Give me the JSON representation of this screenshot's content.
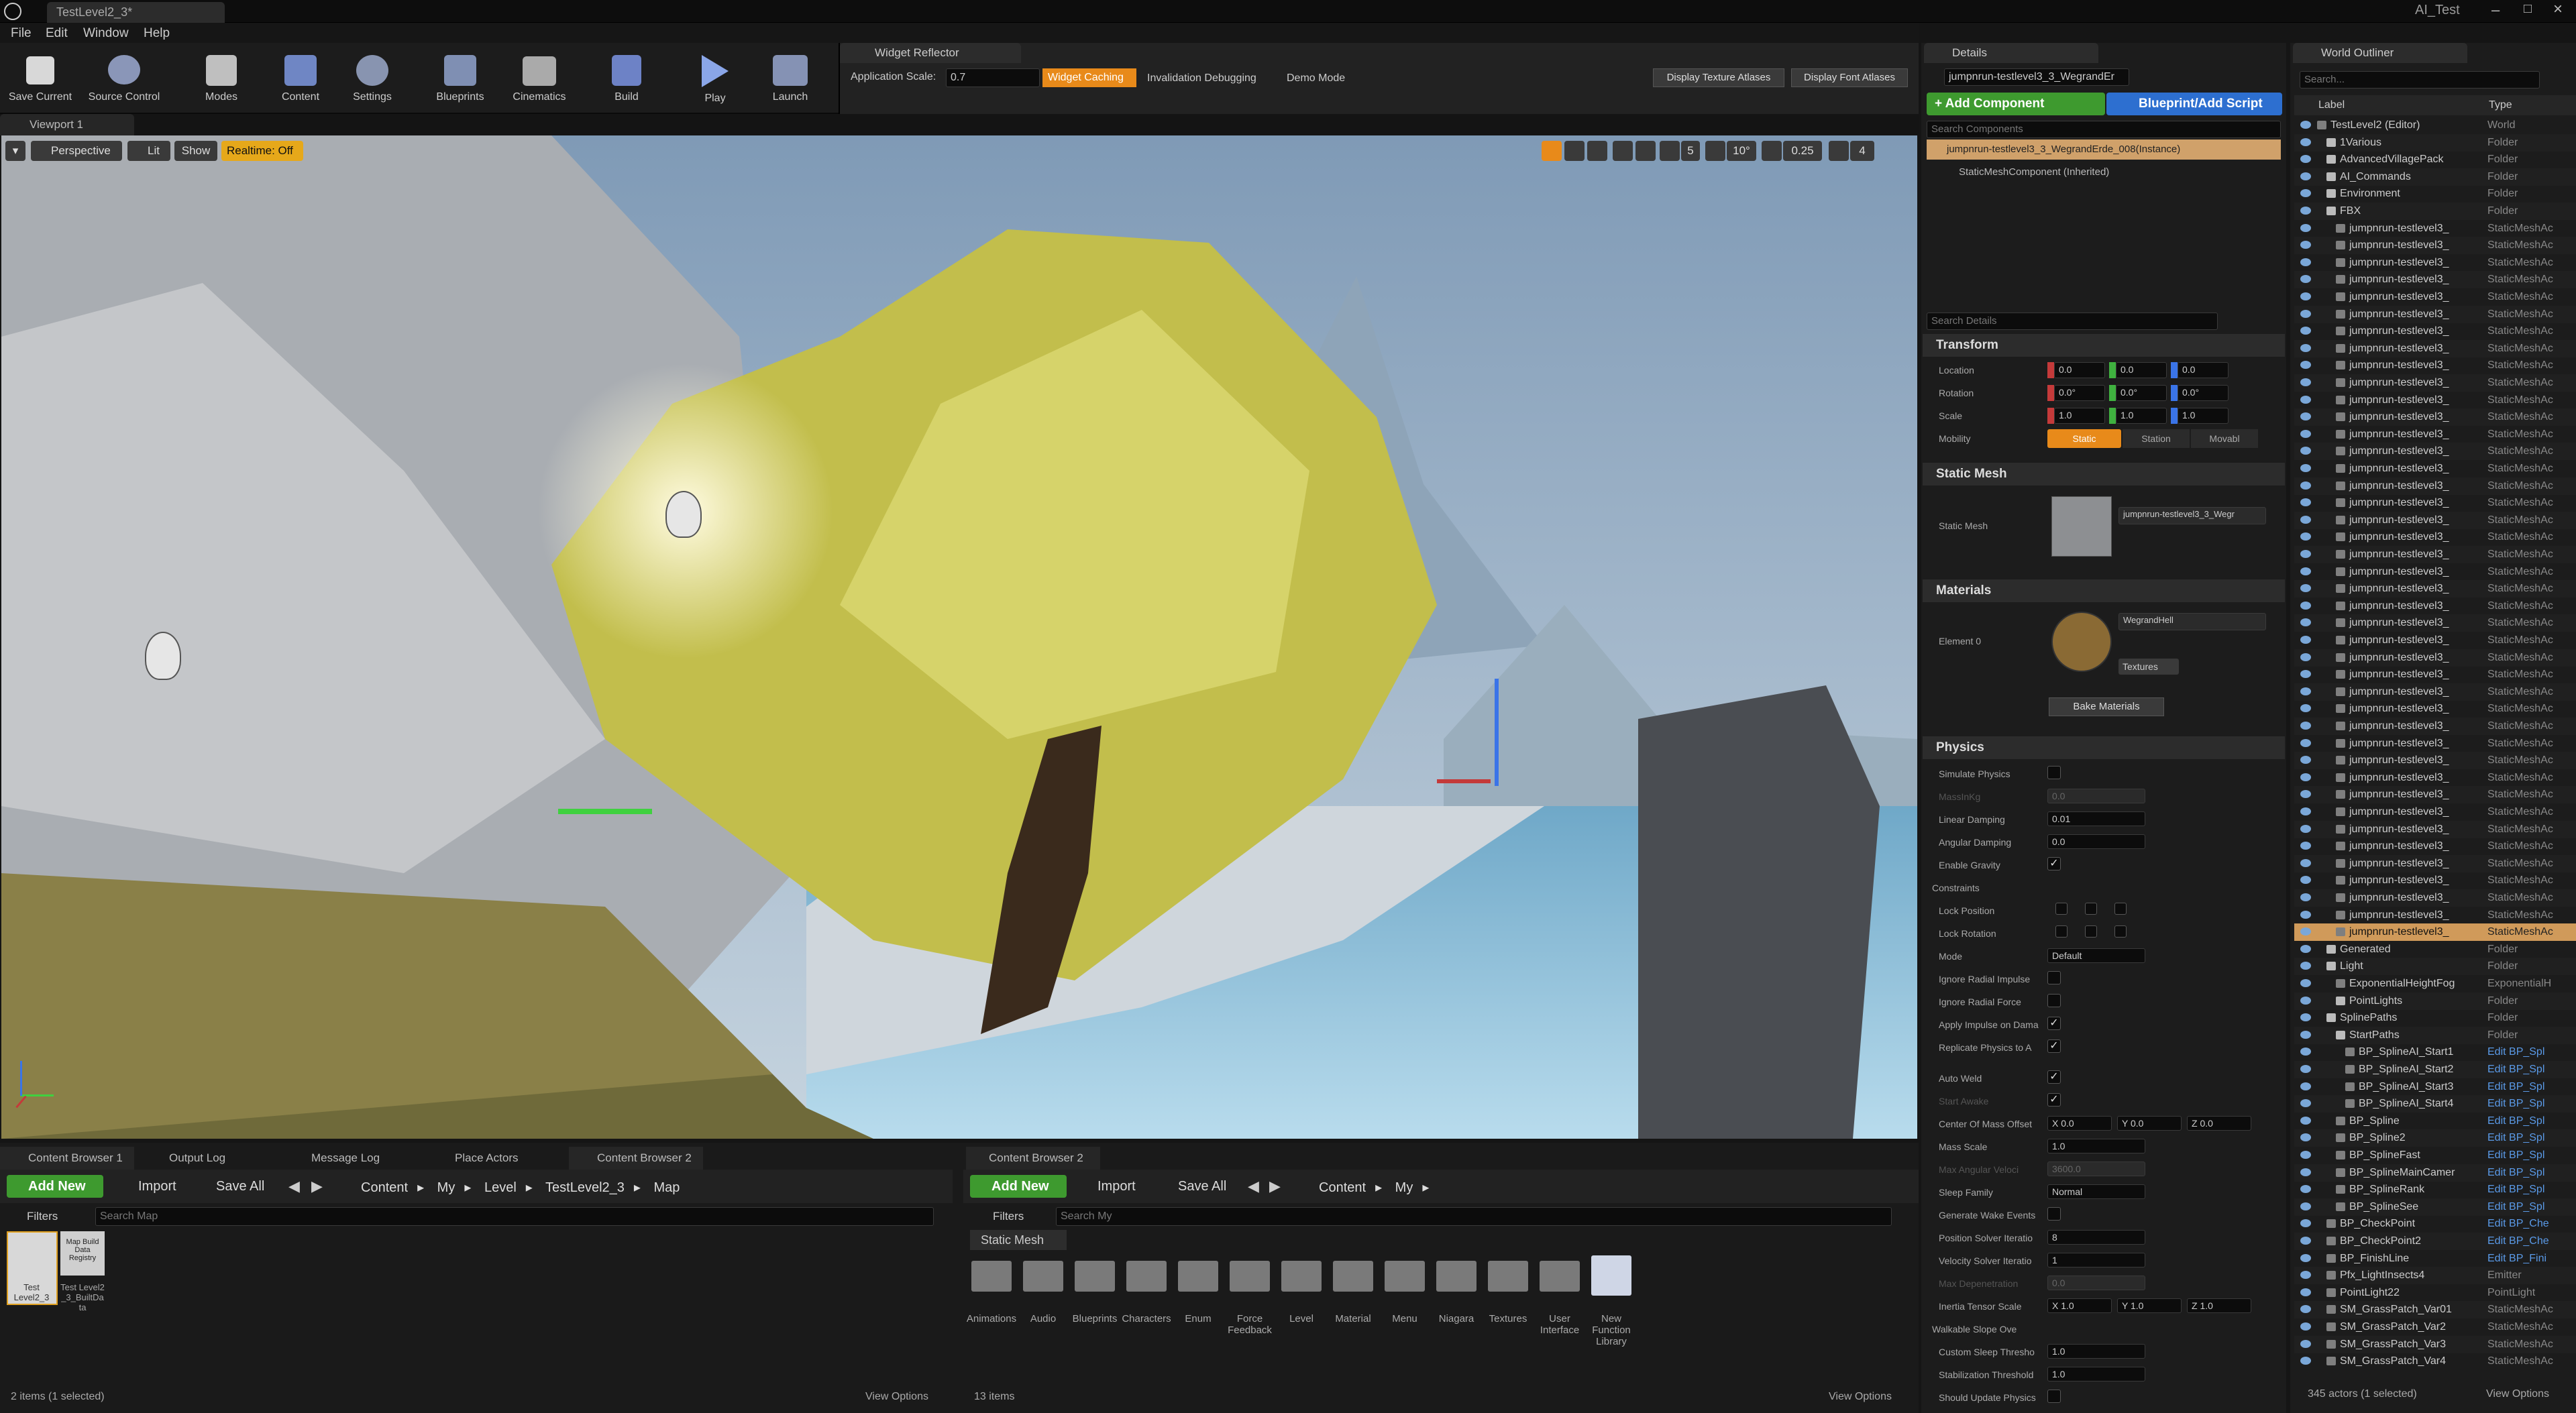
{
  "window": {
    "doc_tab": "TestLevel2_3*",
    "project": "AI_Test"
  },
  "menu": [
    "File",
    "Edit",
    "Window",
    "Help"
  ],
  "toolbar": [
    "Save Current",
    "Source Control",
    "Modes",
    "Content",
    "Settings",
    "Blueprints",
    "Cinematics",
    "Build",
    "Play",
    "Launch"
  ],
  "widget_reflector": {
    "tab": "Widget Reflector",
    "app_scale_label": "Application Scale:",
    "app_scale_value": "0.7",
    "widget_caching": "Widget Caching",
    "invalidation": "Invalidation Debugging",
    "demo": "Demo Mode",
    "tex_atlases": "Display Texture Atlases",
    "font_atlases": "Display Font Atlases"
  },
  "viewport": {
    "tab": "Viewport 1",
    "perspective": "Perspective",
    "lit": "Lit",
    "show": "Show",
    "realtime": "Realtime: Off",
    "grid_num": "5",
    "angle": "10°",
    "scale": "0.25",
    "cams": "4"
  },
  "details": {
    "tab": "Details",
    "name": "jumpnrun-testlevel3_3_WegrandEr",
    "add_component": "+ Add Component",
    "blueprint": "Blueprint/Add Script",
    "search_components": "Search Components",
    "instance": "jumpnrun-testlevel3_3_WegrandErde_008(Instance)",
    "smc": "StaticMeshComponent (Inherited)",
    "search_details": "Search Details",
    "transform": "Transform",
    "location": "Location",
    "rotation": "Rotation",
    "scale": "Scale",
    "mobility": "Mobility",
    "loc": [
      "0.0",
      "0.0",
      "0.0"
    ],
    "rot": [
      "0.0°",
      "0.0°",
      "0.0°"
    ],
    "scl": [
      "1.0",
      "1.0",
      "1.0"
    ],
    "mob": [
      "Static",
      "Station",
      "Movabl"
    ],
    "static_mesh_sec": "Static Mesh",
    "static_mesh_label": "Static Mesh",
    "static_mesh_val": "jumpnrun-testlevel3_3_Wegr",
    "materials_sec": "Materials",
    "element0": "Element 0",
    "material_val": "WegrandHell",
    "textures": "Textures",
    "bake": "Bake Materials",
    "physics_sec": "Physics",
    "simulate": "Simulate Physics",
    "masskg": "MassInKg",
    "masskg_val": "0.0",
    "linear": "Linear Damping",
    "linear_val": "0.01",
    "angular": "Angular Damping",
    "angular_val": "0.0",
    "gravity": "Enable Gravity",
    "constraints": "Constraints",
    "lockpos": "Lock Position",
    "lockrot": "Lock Rotation",
    "mode": "Mode",
    "mode_val": "Default",
    "radial_imp": "Ignore Radial Impulse",
    "radial_force": "Ignore Radial Force",
    "apply_imp": "Apply Impulse on Dama",
    "replicate": "Replicate Physics to A",
    "autoweld": "Auto Weld",
    "start_awake": "Start Awake",
    "com": "Center Of Mass Offset",
    "com_vals": [
      "X 0.0",
      "Y 0.0",
      "Z 0.0"
    ],
    "massscale": "Mass Scale",
    "massscale_val": "1.0",
    "maxang": "Max Angular Veloci",
    "maxang_val": "3600.0",
    "sleepfam": "Sleep Family",
    "sleepfam_val": "Normal",
    "wake": "Generate Wake Events",
    "possolver": "Position Solver Iteratio",
    "possolver_val": "8",
    "velsolver": "Velocity Solver Iteratio",
    "velsolver_val": "1",
    "maxdep": "Max Depenetration",
    "maxdep_val": "0.0",
    "inertia": "Inertia Tensor Scale",
    "inertia_vals": [
      "X 1.0",
      "Y 1.0",
      "Z 1.0"
    ],
    "walkable": "Walkable Slope Ove",
    "customsleep": "Custom Sleep Thresho",
    "customsleep_val": "1.0",
    "stab": "Stabilization Threshold",
    "stab_val": "1.0",
    "shouldupdate": "Should Update Physics"
  },
  "outliner": {
    "tab": "World Outliner",
    "search": "Search...",
    "col_label": "Label",
    "col_type": "Type",
    "footer": "345 actors (1 selected)",
    "view_options": "View Options",
    "rows": [
      {
        "n": "TestLevel2 (Editor)",
        "t": "World",
        "d": 0
      },
      {
        "n": "1Various",
        "t": "Folder",
        "d": 1
      },
      {
        "n": "AdvancedVillagePack",
        "t": "Folder",
        "d": 1
      },
      {
        "n": "AI_Commands",
        "t": "Folder",
        "d": 1
      },
      {
        "n": "Environment",
        "t": "Folder",
        "d": 1
      },
      {
        "n": "FBX",
        "t": "Folder",
        "d": 1
      },
      {
        "n": "jumpnrun-testlevel3_",
        "t": "StaticMeshAc",
        "d": 2
      },
      {
        "n": "jumpnrun-testlevel3_",
        "t": "StaticMeshAc",
        "d": 2
      },
      {
        "n": "jumpnrun-testlevel3_",
        "t": "StaticMeshAc",
        "d": 2
      },
      {
        "n": "jumpnrun-testlevel3_",
        "t": "StaticMeshAc",
        "d": 2
      },
      {
        "n": "jumpnrun-testlevel3_",
        "t": "StaticMeshAc",
        "d": 2
      },
      {
        "n": "jumpnrun-testlevel3_",
        "t": "StaticMeshAc",
        "d": 2
      },
      {
        "n": "jumpnrun-testlevel3_",
        "t": "StaticMeshAc",
        "d": 2
      },
      {
        "n": "jumpnrun-testlevel3_",
        "t": "StaticMeshAc",
        "d": 2
      },
      {
        "n": "jumpnrun-testlevel3_",
        "t": "StaticMeshAc",
        "d": 2
      },
      {
        "n": "jumpnrun-testlevel3_",
        "t": "StaticMeshAc",
        "d": 2
      },
      {
        "n": "jumpnrun-testlevel3_",
        "t": "StaticMeshAc",
        "d": 2
      },
      {
        "n": "jumpnrun-testlevel3_",
        "t": "StaticMeshAc",
        "d": 2
      },
      {
        "n": "jumpnrun-testlevel3_",
        "t": "StaticMeshAc",
        "d": 2
      },
      {
        "n": "jumpnrun-testlevel3_",
        "t": "StaticMeshAc",
        "d": 2
      },
      {
        "n": "jumpnrun-testlevel3_",
        "t": "StaticMeshAc",
        "d": 2
      },
      {
        "n": "jumpnrun-testlevel3_",
        "t": "StaticMeshAc",
        "d": 2
      },
      {
        "n": "jumpnrun-testlevel3_",
        "t": "StaticMeshAc",
        "d": 2
      },
      {
        "n": "jumpnrun-testlevel3_",
        "t": "StaticMeshAc",
        "d": 2
      },
      {
        "n": "jumpnrun-testlevel3_",
        "t": "StaticMeshAc",
        "d": 2
      },
      {
        "n": "jumpnrun-testlevel3_",
        "t": "StaticMeshAc",
        "d": 2
      },
      {
        "n": "jumpnrun-testlevel3_",
        "t": "StaticMeshAc",
        "d": 2
      },
      {
        "n": "jumpnrun-testlevel3_",
        "t": "StaticMeshAc",
        "d": 2
      },
      {
        "n": "jumpnrun-testlevel3_",
        "t": "StaticMeshAc",
        "d": 2
      },
      {
        "n": "jumpnrun-testlevel3_",
        "t": "StaticMeshAc",
        "d": 2
      },
      {
        "n": "jumpnrun-testlevel3_",
        "t": "StaticMeshAc",
        "d": 2
      },
      {
        "n": "jumpnrun-testlevel3_",
        "t": "StaticMeshAc",
        "d": 2
      },
      {
        "n": "jumpnrun-testlevel3_",
        "t": "StaticMeshAc",
        "d": 2
      },
      {
        "n": "jumpnrun-testlevel3_",
        "t": "StaticMeshAc",
        "d": 2
      },
      {
        "n": "jumpnrun-testlevel3_",
        "t": "StaticMeshAc",
        "d": 2
      },
      {
        "n": "jumpnrun-testlevel3_",
        "t": "StaticMeshAc",
        "d": 2
      },
      {
        "n": "jumpnrun-testlevel3_",
        "t": "StaticMeshAc",
        "d": 2
      },
      {
        "n": "jumpnrun-testlevel3_",
        "t": "StaticMeshAc",
        "d": 2
      },
      {
        "n": "jumpnrun-testlevel3_",
        "t": "StaticMeshAc",
        "d": 2
      },
      {
        "n": "jumpnrun-testlevel3_",
        "t": "StaticMeshAc",
        "d": 2
      },
      {
        "n": "jumpnrun-testlevel3_",
        "t": "StaticMeshAc",
        "d": 2
      },
      {
        "n": "jumpnrun-testlevel3_",
        "t": "StaticMeshAc",
        "d": 2
      },
      {
        "n": "jumpnrun-testlevel3_",
        "t": "StaticMeshAc",
        "d": 2
      },
      {
        "n": "jumpnrun-testlevel3_",
        "t": "StaticMeshAc",
        "d": 2
      },
      {
        "n": "jumpnrun-testlevel3_",
        "t": "StaticMeshAc",
        "d": 2
      },
      {
        "n": "jumpnrun-testlevel3_",
        "t": "StaticMeshAc",
        "d": 2
      },
      {
        "n": "jumpnrun-testlevel3_",
        "t": "StaticMeshAc",
        "d": 2
      },
      {
        "n": "jumpnrun-testlevel3_",
        "t": "StaticMeshAc",
        "d": 2,
        "sel": true
      },
      {
        "n": "Generated",
        "t": "Folder",
        "d": 1
      },
      {
        "n": "Light",
        "t": "Folder",
        "d": 1
      },
      {
        "n": "ExponentialHeightFog",
        "t": "ExponentialH",
        "d": 2
      },
      {
        "n": "PointLights",
        "t": "Folder",
        "d": 2
      },
      {
        "n": "SplinePaths",
        "t": "Folder",
        "d": 1
      },
      {
        "n": "StartPaths",
        "t": "Folder",
        "d": 2
      },
      {
        "n": "BP_SplineAI_Start1",
        "t": "Edit BP_Spl",
        "d": 3,
        "link": true
      },
      {
        "n": "BP_SplineAI_Start2",
        "t": "Edit BP_Spl",
        "d": 3,
        "link": true
      },
      {
        "n": "BP_SplineAI_Start3",
        "t": "Edit BP_Spl",
        "d": 3,
        "link": true
      },
      {
        "n": "BP_SplineAI_Start4",
        "t": "Edit BP_Spl",
        "d": 3,
        "link": true
      },
      {
        "n": "BP_Spline",
        "t": "Edit BP_Spl",
        "d": 2,
        "link": true
      },
      {
        "n": "BP_Spline2",
        "t": "Edit BP_Spl",
        "d": 2,
        "link": true
      },
      {
        "n": "BP_SplineFast",
        "t": "Edit BP_Spl",
        "d": 2,
        "link": true
      },
      {
        "n": "BP_SplineMainCamer",
        "t": "Edit BP_Spl",
        "d": 2,
        "link": true
      },
      {
        "n": "BP_SplineRank",
        "t": "Edit BP_Spl",
        "d": 2,
        "link": true
      },
      {
        "n": "BP_SplineSee",
        "t": "Edit BP_Spl",
        "d": 2,
        "link": true
      },
      {
        "n": "BP_CheckPoint",
        "t": "Edit BP_Che",
        "d": 1,
        "link": true
      },
      {
        "n": "BP_CheckPoint2",
        "t": "Edit BP_Che",
        "d": 1,
        "link": true
      },
      {
        "n": "BP_FinishLine",
        "t": "Edit BP_Fini",
        "d": 1,
        "link": true
      },
      {
        "n": "Pfx_LightInsects4",
        "t": "Emitter",
        "d": 1
      },
      {
        "n": "PointLight22",
        "t": "PointLight",
        "d": 1
      },
      {
        "n": "SM_GrassPatch_Var01",
        "t": "StaticMeshAc",
        "d": 1
      },
      {
        "n": "SM_GrassPatch_Var2",
        "t": "StaticMeshAc",
        "d": 1
      },
      {
        "n": "SM_GrassPatch_Var3",
        "t": "StaticMeshAc",
        "d": 1
      },
      {
        "n": "SM_GrassPatch_Var4",
        "t": "StaticMeshAc",
        "d": 1
      }
    ]
  },
  "bottom_tabs": [
    "Content Browser 1",
    "Output Log",
    "Message Log",
    "Place Actors",
    "Content Browser 2"
  ],
  "cb1": {
    "add_new": "Add New",
    "import": "Import",
    "save_all": "Save All",
    "path": [
      "Content",
      "My",
      "Level",
      "TestLevel2_3",
      "Map"
    ],
    "filters": "Filters",
    "search": "Search Map",
    "items": [
      "Test Level2_3",
      "Test Level2_3_BuiltData"
    ],
    "registry": "Map Build Data Registry",
    "footer": "2 items (1 selected)",
    "view_options": "View Options"
  },
  "cb2": {
    "tab": "Content Browser 2",
    "add_new": "Add New",
    "import": "Import",
    "save_all": "Save All",
    "path": [
      "Content",
      "My"
    ],
    "filters": "Filters",
    "search": "Search My",
    "filter_chip": "Static Mesh",
    "folders": [
      "Animations",
      "Audio",
      "Blueprints",
      "Characters",
      "Enum",
      "Force Feedback",
      "Level",
      "Material",
      "Menu",
      "Niagara",
      "Textures",
      "User Interface",
      "New Function Library"
    ],
    "footer": "13 items",
    "view_options": "View Options"
  }
}
